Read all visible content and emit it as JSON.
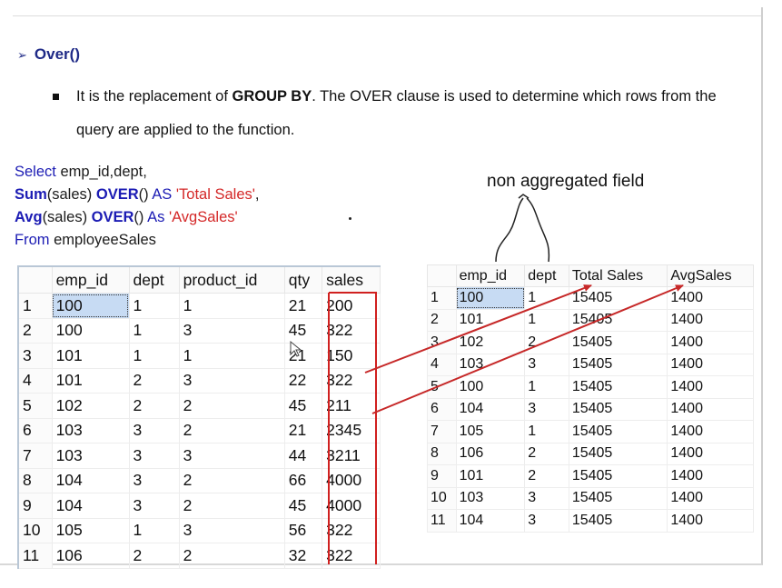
{
  "heading": {
    "marker": "➢",
    "title": "Over()"
  },
  "bullet": {
    "prefix": "It is the replacement of ",
    "bold": "GROUP BY",
    "suffix": ". The OVER clause is used to determine which rows from the query are applied to the function."
  },
  "sql": {
    "line1": {
      "kw": "Select",
      "rest": " emp_id,dept,"
    },
    "line2": {
      "fn": "Sum",
      "args": "(sales) ",
      "over": "OVER",
      "paren": "() ",
      "as": "AS",
      "alias": " 'Total Sales'",
      "comma": ","
    },
    "line3": {
      "fn": "Avg",
      "args": "(sales) ",
      "over": "OVER",
      "paren": "() ",
      "as": "As",
      "alias": " 'AvgSales'"
    },
    "line4": {
      "kw": "From",
      "rest": " employeeSales"
    }
  },
  "annotation": "non aggregated field",
  "left_table": {
    "columns": [
      "",
      "emp_id",
      "dept",
      "product_id",
      "qty",
      "sales"
    ],
    "rows": [
      [
        "1",
        "100",
        "1",
        "1",
        "21",
        "200"
      ],
      [
        "2",
        "100",
        "1",
        "3",
        "45",
        "322"
      ],
      [
        "3",
        "101",
        "1",
        "1",
        "21",
        "150"
      ],
      [
        "4",
        "101",
        "2",
        "3",
        "22",
        "322"
      ],
      [
        "5",
        "102",
        "2",
        "2",
        "45",
        "211"
      ],
      [
        "6",
        "103",
        "3",
        "2",
        "21",
        "2345"
      ],
      [
        "7",
        "103",
        "3",
        "3",
        "44",
        "3211"
      ],
      [
        "8",
        "104",
        "3",
        "2",
        "66",
        "4000"
      ],
      [
        "9",
        "104",
        "3",
        "2",
        "45",
        "4000"
      ],
      [
        "10",
        "105",
        "1",
        "3",
        "56",
        "322"
      ],
      [
        "11",
        "106",
        "2",
        "2",
        "32",
        "322"
      ]
    ]
  },
  "right_table": {
    "columns": [
      "",
      "emp_id",
      "dept",
      "Total Sales",
      "AvgSales"
    ],
    "rows": [
      [
        "1",
        "100",
        "1",
        "15405",
        "1400"
      ],
      [
        "2",
        "101",
        "1",
        "15405",
        "1400"
      ],
      [
        "3",
        "102",
        "2",
        "15405",
        "1400"
      ],
      [
        "4",
        "103",
        "3",
        "15405",
        "1400"
      ],
      [
        "5",
        "100",
        "1",
        "15405",
        "1400"
      ],
      [
        "6",
        "104",
        "3",
        "15405",
        "1400"
      ],
      [
        "7",
        "105",
        "1",
        "15405",
        "1400"
      ],
      [
        "8",
        "106",
        "2",
        "15405",
        "1400"
      ],
      [
        "9",
        "101",
        "2",
        "15405",
        "1400"
      ],
      [
        "10",
        "103",
        "3",
        "15405",
        "1400"
      ],
      [
        "11",
        "104",
        "3",
        "15405",
        "1400"
      ]
    ]
  },
  "colors": {
    "keyword": "#1c1cb4",
    "string": "#d42828",
    "heading": "#1f2a87",
    "marker": "#c0392b",
    "selection": "#c7dbf3"
  }
}
